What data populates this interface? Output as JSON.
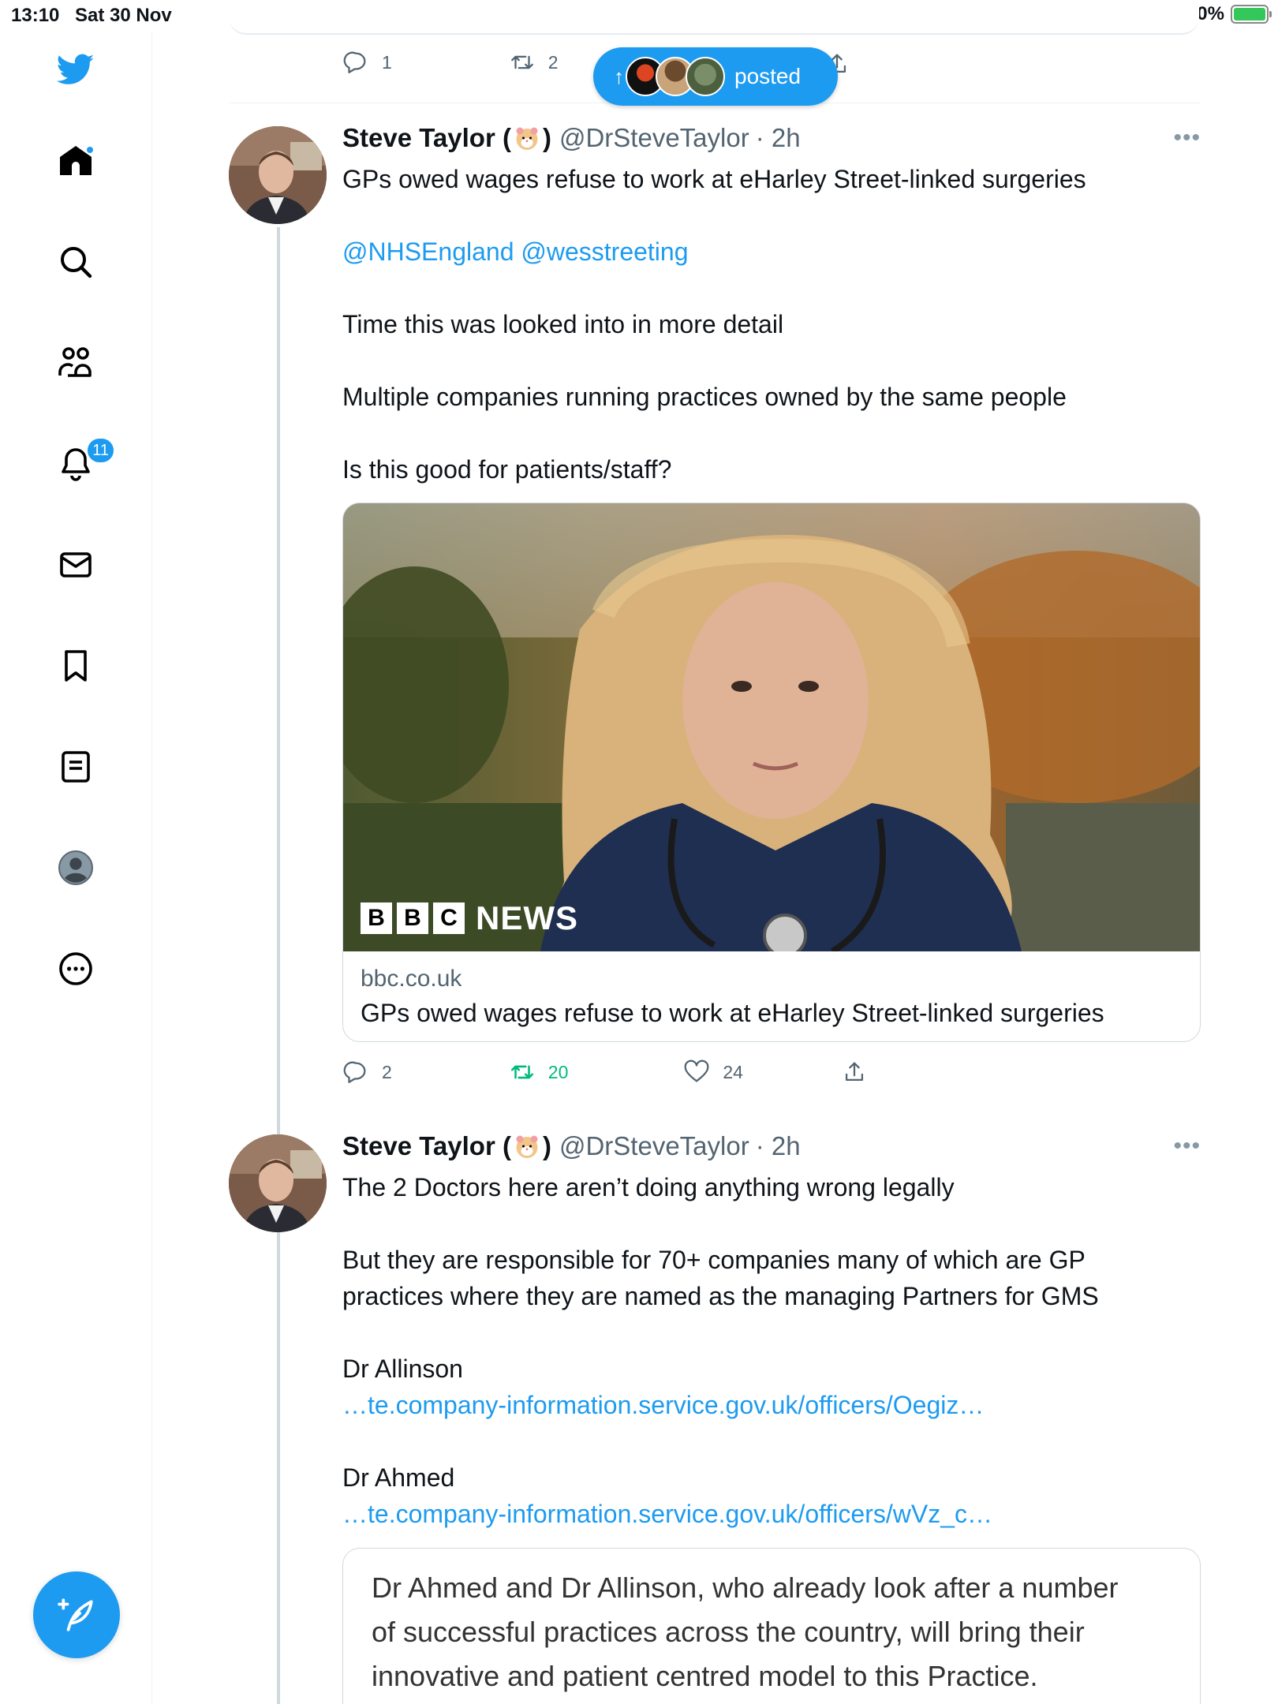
{
  "status_bar": {
    "time": "13:10",
    "date": "Sat 30 Nov",
    "battery": "100%"
  },
  "sidebar": {
    "items": [
      {
        "name": "home",
        "icon": "home-icon"
      },
      {
        "name": "explore",
        "icon": "search-icon"
      },
      {
        "name": "communities",
        "icon": "communities-icon"
      },
      {
        "name": "notifications",
        "icon": "bell-icon",
        "badge": "11"
      },
      {
        "name": "messages",
        "icon": "mail-icon"
      },
      {
        "name": "bookmarks",
        "icon": "bookmark-icon"
      },
      {
        "name": "lists",
        "icon": "list-icon"
      },
      {
        "name": "profile",
        "icon": "profile-icon"
      },
      {
        "name": "more",
        "icon": "more-circle-icon"
      }
    ],
    "accent": "#1d9bf0"
  },
  "posted_pill": {
    "label": "posted"
  },
  "prev_tweet_actions": {
    "replies": "1",
    "retweets": "2"
  },
  "tweets": [
    {
      "name_prefix": "Steve Taylor (",
      "name_suffix": ")",
      "handle": "@DrSteveTaylor",
      "time": "· 2h",
      "lines": [
        "GPs owed wages refuse to work at eHarley Street-linked surgeries",
        "@NHSEngland @wesstreeting",
        "Time this was looked into in more detail",
        "Multiple companies running practices owned by the same people",
        "Is this good for patients/staff?"
      ],
      "card": {
        "domain": "bbc.co.uk",
        "title": "GPs owed wages refuse to work at eHarley Street-linked surgeries",
        "logo_letters": [
          "B",
          "B",
          "C"
        ],
        "logo_word": "NEWS"
      },
      "actions": {
        "replies": "2",
        "retweets": "20",
        "likes": "24"
      }
    },
    {
      "name_prefix": "Steve Taylor (",
      "name_suffix": ")",
      "handle": "@DrSteveTaylor",
      "time": "· 2h",
      "lines": [
        "The 2 Doctors here aren’t doing anything wrong legally",
        "But they are responsible for 70+ companies many of which are GP",
        "practices where they are named as the managing Partners for GMS",
        "Dr Allinson",
        "…te.company-information.service.gov.uk/officers/Oegiz…",
        "Dr Ahmed",
        "…te.company-information.service.gov.uk/officers/wVz_c…"
      ],
      "quote_lines": [
        "Dr Ahmed and Dr Allinson, who already look after a number",
        "of successful practices across the country, will bring their",
        "innovative and patient centred model to this Practice."
      ]
    }
  ]
}
